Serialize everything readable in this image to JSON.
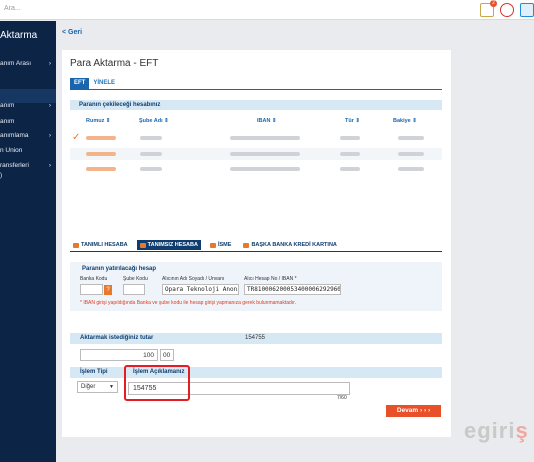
{
  "topbar": {
    "search_placeholder": "Ara...",
    "notification_count": "2"
  },
  "sidebar": {
    "title": "Aktarma",
    "items": [
      {
        "label": "anım Arası",
        "has_chevron": true
      },
      {
        "label": "anım",
        "has_chevron": true
      },
      {
        "label": "anım",
        "has_chevron": false
      },
      {
        "label": "anımlama",
        "has_chevron": true
      },
      {
        "label": "n Union",
        "has_chevron": false
      },
      {
        "label": "ransferleri",
        "has_chevron": true
      },
      {
        "label": ")",
        "has_chevron": false
      }
    ]
  },
  "nav": {
    "back_label": "< Geri"
  },
  "page": {
    "title": "Para Aktarma - EFT",
    "tabs": [
      {
        "label": "EFT",
        "active": true
      },
      {
        "label": "YİNELE",
        "active": false
      }
    ]
  },
  "source_account": {
    "section_title": "Paranın çekileceği hesabınız",
    "columns": [
      "Rumuz ⇕",
      "Şube Adı ⇕",
      "IBAN ⇕",
      "Tür ⇕",
      "Bakiye ⇕"
    ]
  },
  "transfer_types": {
    "tabs": [
      {
        "label": "TANIMLI HESABA",
        "active": false
      },
      {
        "label": "TANIMSIZ HESABA",
        "active": true
      },
      {
        "label": "İSME",
        "active": false
      },
      {
        "label": "BAŞKA BANKA KREDİ KARTINA",
        "active": false
      }
    ]
  },
  "recipient": {
    "section_title": "Paranın yatırılacağı hesap",
    "bank_code_label": "Banka Kodu",
    "branch_code_label": "Şube Kodu",
    "name_label": "Alıcının Adı Soyadı / Unvanı",
    "iban_label": "Alıcı Hesap No / IBAN *",
    "name_value": "Opara Teknoloji Anonim",
    "iban_value": "TR8100062000534000062929606",
    "help_button": "?",
    "warning": "* IBAN girişi yapıldığında Banka ve şube kodu ile hesap girişi yapmanıza gerek bulunmamaktadır."
  },
  "amount": {
    "label": "Aktarmak istediğiniz tutar",
    "reference_value": "154755",
    "main_value": "100",
    "cents_value": "00"
  },
  "operation": {
    "type_label": "İşlem Tipi",
    "type_value": "Diğer",
    "description_label": "İşlem Açıklamanız",
    "description_value": "154755",
    "counter": "7/60"
  },
  "actions": {
    "continue_label": "Devam  › › ›"
  },
  "watermark": {
    "part1": "egiri",
    "part2": "ş"
  }
}
